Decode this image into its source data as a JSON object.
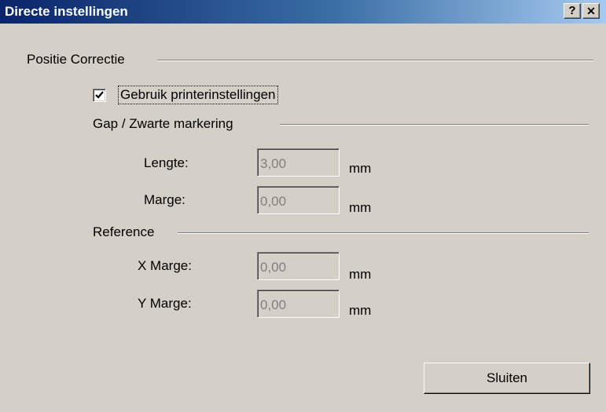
{
  "window": {
    "title": "Directe instellingen",
    "help_label": "?",
    "close_label": "✕"
  },
  "position_group": {
    "label": "Positie Correctie",
    "checkbox": {
      "label": "Gebruik printerinstellingen",
      "checked": true
    }
  },
  "gap_group": {
    "label": "Gap / Zwarte markering",
    "fields": [
      {
        "label": "Lengte:",
        "value": "3,00",
        "unit": "mm"
      },
      {
        "label": "Marge:",
        "value": "0,00",
        "unit": "mm"
      }
    ]
  },
  "reference_group": {
    "label": "Reference",
    "fields": [
      {
        "label": "X Marge:",
        "value": "0,00",
        "unit": "mm"
      },
      {
        "label": "Y Marge:",
        "value": "0,00",
        "unit": "mm"
      }
    ]
  },
  "buttons": {
    "close_label": "Sluiten"
  },
  "colors": {
    "face": "#d4d0c8",
    "title_start": "#0a246a",
    "title_end": "#a6caf0",
    "disabled_text": "#808080"
  }
}
